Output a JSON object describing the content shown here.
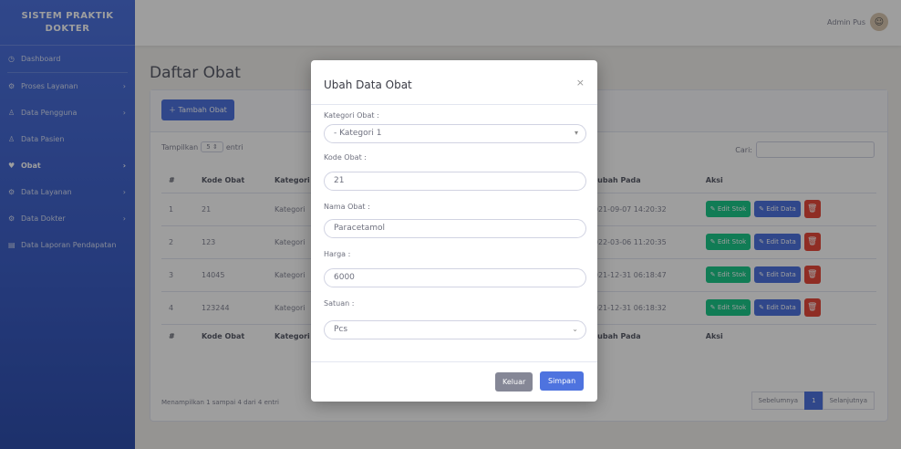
{
  "sidebar": {
    "brand_line1": "SISTEM PRAKTIK",
    "brand_line2": "DOKTER",
    "items": [
      {
        "label": "Dashboard",
        "icon": "dashboard-icon"
      },
      {
        "label": "Proses Layanan",
        "icon": "cog-icon"
      },
      {
        "label": "Data Pengguna",
        "icon": "user-icon"
      },
      {
        "label": "Data Pasien",
        "icon": "user-icon"
      },
      {
        "label": "Obat",
        "icon": "heart-icon"
      },
      {
        "label": "Data Layanan",
        "icon": "cog-icon"
      },
      {
        "label": "Data Dokter",
        "icon": "cog-icon"
      },
      {
        "label": "Data Laporan Pendapatan",
        "icon": "file-icon"
      }
    ]
  },
  "topbar": {
    "user_name": "Admin Pus"
  },
  "page": {
    "title": "Daftar Obat"
  },
  "card": {
    "add_button": "Tambah Obat",
    "length_prefix": "Tampilkan",
    "length_value": "5",
    "length_suffix": "entri",
    "search_label": "Cari:"
  },
  "table": {
    "headers": {
      "no": "#",
      "kode": "Kode Obat",
      "kategori": "Kategori",
      "diubah": "Diubah Pada",
      "aksi": "Aksi"
    },
    "rows": [
      {
        "no": "1",
        "kode": "21",
        "kategori": "Kategori",
        "diubah": "2021-09-07 14:20:32"
      },
      {
        "no": "2",
        "kode": "123",
        "kategori": "Kategori",
        "diubah": "2022-03-06 11:20:35"
      },
      {
        "no": "3",
        "kode": "14045",
        "kategori": "Kategori",
        "diubah": "2021-12-31 06:18:47"
      },
      {
        "no": "4",
        "kode": "123244",
        "kategori": "Kategori",
        "diubah": "2021-12-31 06:18:32"
      }
    ],
    "action_stok": "Edit Stok",
    "action_data": "Edit Data",
    "info": "Menampilkan 1 sampai 4 dari 4 entri",
    "pager": {
      "prev": "Sebelumnya",
      "current": "1",
      "next": "Selanjutnya"
    }
  },
  "modal": {
    "title": "Ubah Data Obat",
    "close": "×",
    "kategori_label": "Kategori Obat :",
    "kategori_value": "- Kategori 1",
    "kode_label": "Kode Obat :",
    "kode_value": "21",
    "nama_label": "Nama Obat :",
    "nama_value": "Paracetamol",
    "harga_label": "Harga :",
    "harga_value": "6000",
    "satuan_label": "Satuan :",
    "satuan_value": "Pcs",
    "btn_keluar": "Keluar",
    "btn_simpan": "Simpan"
  },
  "colors": {
    "primary": "#4e73df",
    "success": "#1cc88a",
    "danger": "#e74a3b",
    "secondary": "#858796"
  }
}
